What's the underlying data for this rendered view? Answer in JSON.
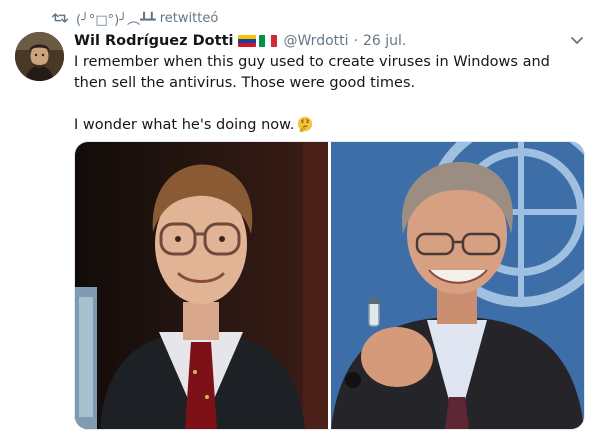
{
  "retweet": {
    "user": "(╯°□°)╯︵┻┻",
    "label": "retwitteó"
  },
  "tweet": {
    "display_name": "Wil Rodríguez Dotti",
    "flags": [
      "venezuela-flag",
      "italy-flag"
    ],
    "handle": "@Wrdotti",
    "separator": "·",
    "date": "26 jul.",
    "text_line1": "I remember when this guy used to create viruses in Windows and then sell the antivirus. Those were good times.",
    "text_line2": "I wonder what he's doing now.",
    "emoji": "thinking-face-emoji"
  },
  "media": {
    "photos": [
      {
        "description_icon": "young-man-with-glasses-photo"
      },
      {
        "description_icon": "older-man-holding-vial-photo"
      }
    ]
  },
  "colors": {
    "text": "#14171a",
    "muted": "#657786",
    "border": "#e1e8ed"
  }
}
